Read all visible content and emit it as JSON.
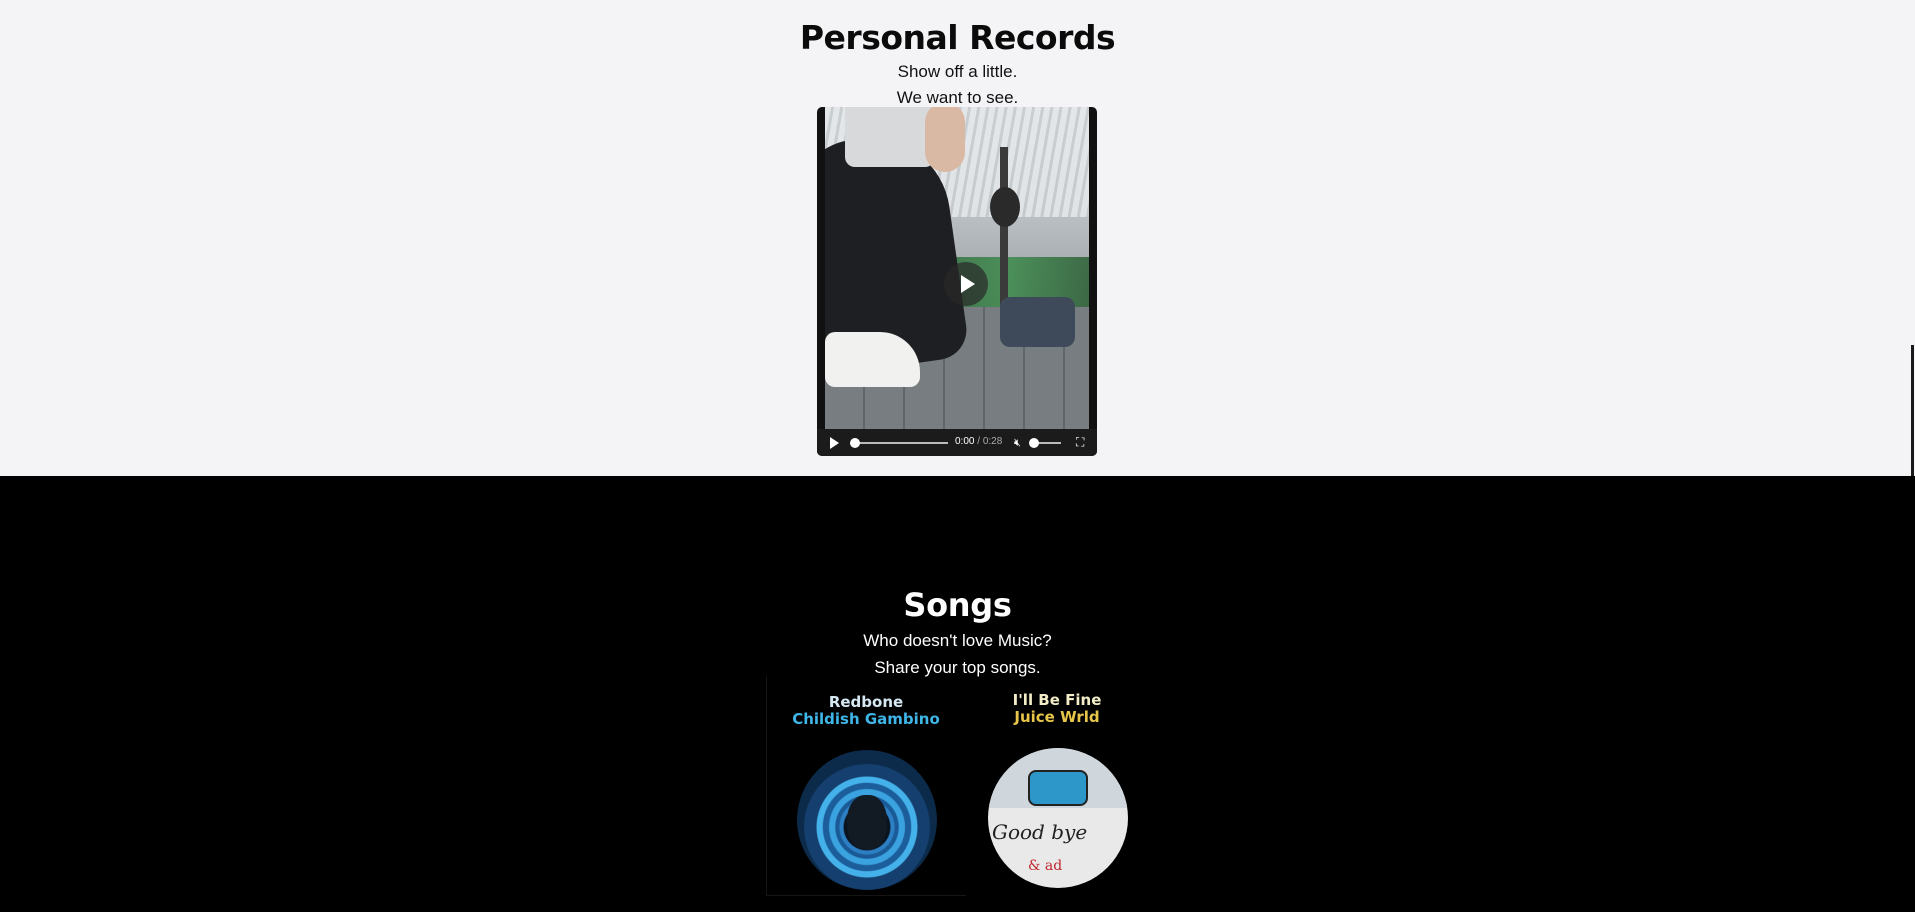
{
  "records": {
    "title": "Personal Records",
    "subtitle_line1": "Show off a little.",
    "subtitle_line2": "We want to see.",
    "video": {
      "current_time": "0:00",
      "separator": " / ",
      "duration": "0:28",
      "progress": 0,
      "muted": true,
      "volume_level": 0
    }
  },
  "songs": {
    "title": "Songs",
    "subtitle_line1": "Who doesn't love Music?",
    "subtitle_line2": "Share your top songs.",
    "items": [
      {
        "name": "Redbone",
        "artist": "Childish Gambino",
        "name_color": "#d6e9f3",
        "artist_color": "#3fb6e8"
      },
      {
        "name": "I'll Be Fine",
        "artist": "Juice Wrld",
        "name_color": "#f2ecc8",
        "artist_color": "#e8c64a"
      }
    ]
  },
  "icons": {
    "video_play": "play-icon",
    "control_play": "play-icon",
    "volume": "muted-speaker-icon",
    "fullscreen": "fullscreen-icon"
  }
}
